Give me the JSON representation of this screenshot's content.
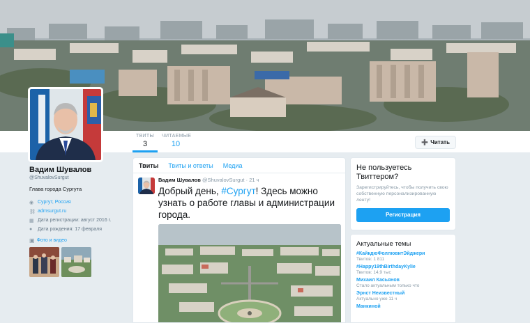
{
  "nav": {
    "tweets": {
      "label": "Твиты",
      "value": "3"
    },
    "followers": {
      "label": "Читаемые",
      "value": "10"
    },
    "follow_button": "Читать"
  },
  "profile": {
    "name": "Вадим Шувалов",
    "handle": "@ShuvalovSurgut",
    "bio": "Глава города Сургута",
    "location": "Сургут, Россия",
    "website": "admsurgut.ru",
    "joined": "Дата регистрации: август 2016 г.",
    "birthday": "Дата рождения: 17 февраля",
    "photos_label": "Фото и видео"
  },
  "timeline": {
    "tabs": [
      "Твиты",
      "Твиты и ответы",
      "Медиа"
    ],
    "tweet": {
      "author": "Вадим Шувалов",
      "handle": "@ShuvalovSurgut",
      "time": "· 21 ч",
      "text_before": "Добрый день, ",
      "hashtag": "#Сургут",
      "text_after": "! Здесь можно узнать о работе главы и администрации города."
    }
  },
  "signup": {
    "title": "Не пользуетесь Твиттером?",
    "desc": "Зарегистрируйтесь, чтобы получить свою собственную персонализированную ленту!",
    "button": "Регистрация"
  },
  "trends": {
    "title": "Актуальные темы",
    "items": [
      {
        "name": "#КайкдюФоллювитЭйджери",
        "sub": "Твитов: 1 811"
      },
      {
        "name": "#Happy19thBirthdayKylie",
        "sub": "Твитов: 14,9 тыс"
      },
      {
        "name": "Михаил Касьянов",
        "sub": "Стало актуальным только что"
      },
      {
        "name": "Эрнст Неизвестный",
        "sub": "Актуально уже 11 ч"
      },
      {
        "name": "Манкиной",
        "sub": ""
      }
    ]
  },
  "colors": {
    "accent": "#1da1f2",
    "background": "#e6ecf0"
  }
}
